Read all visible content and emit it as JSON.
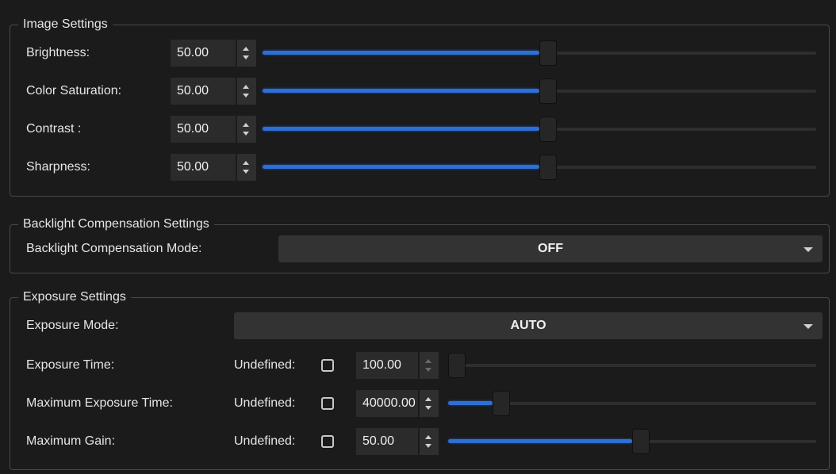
{
  "image_settings": {
    "title": "Image Settings",
    "rows": [
      {
        "label": "Brightness:",
        "value": "50.00",
        "level": 0.5
      },
      {
        "label": "Color Saturation:",
        "value": "50.00",
        "level": 0.5
      },
      {
        "label": "Contrast :",
        "value": "50.00",
        "level": 0.5
      },
      {
        "label": "Sharpness:",
        "value": "50.00",
        "level": 0.5
      }
    ]
  },
  "backlight_settings": {
    "title": "Backlight Compensation Settings",
    "mode_label": "Backlight Compensation Mode:",
    "mode_value": "OFF"
  },
  "exposure_settings": {
    "title": "Exposure Settings",
    "mode_label": "Exposure Mode:",
    "mode_value": "AUTO",
    "rows": [
      {
        "label": "Exposure Time:",
        "undefined_label": "Undefined:",
        "undefined_checked": false,
        "value": "100.00",
        "level": 0.0
      },
      {
        "label": "Maximum Exposure Time:",
        "undefined_label": "Undefined:",
        "undefined_checked": false,
        "value": "40000.00",
        "level": 0.12
      },
      {
        "label": "Maximum Gain:",
        "undefined_label": "Undefined:",
        "undefined_checked": false,
        "value": "50.00",
        "level": 0.5
      }
    ]
  },
  "colors": {
    "accent": "#2e6fd4",
    "background": "#1b1b1b",
    "border": "#4a4a4a"
  }
}
